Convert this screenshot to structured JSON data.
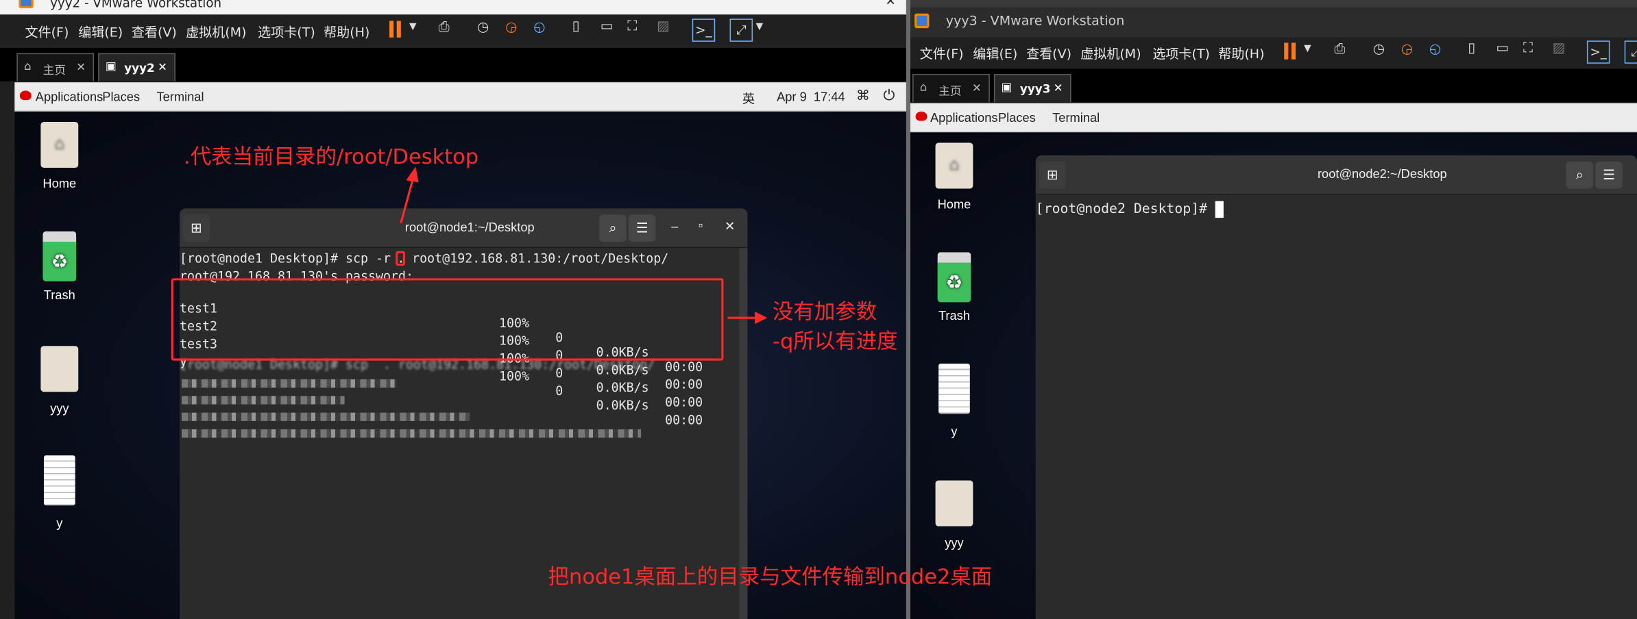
{
  "left": {
    "title": "yyy2 - VMware Workstation",
    "menu": [
      "文件(F)",
      "编辑(E)",
      "查看(V)",
      "虚拟机(M)",
      "选项卡(T)",
      "帮助(H)"
    ],
    "tabs": {
      "home": "主页",
      "vm": "yyy2"
    },
    "panel": {
      "applications": "Applications",
      "places": "Places",
      "terminal": "Terminal",
      "input": "英",
      "clock": "Apr 9  17:44"
    },
    "desktop": {
      "home": "Home",
      "trash": "Trash",
      "folder": "yyy",
      "file": "y"
    },
    "terminal": {
      "title": "root@node1:~/Desktop",
      "prompt_cmd": "[root@node1 Desktop]# scp -r ",
      "dot": ".",
      "cmd_rest": " root@192.168.81.130:/root/Desktop/",
      "password": "root@192.168.81.130's password:",
      "files": [
        {
          "name": "test1",
          "pct": "100%",
          "size": "0",
          "rate": "0.0KB/s",
          "time": "00:00"
        },
        {
          "name": "test2",
          "pct": "100%",
          "size": "0",
          "rate": "0.0KB/s",
          "time": "00:00"
        },
        {
          "name": "test3",
          "pct": "100%",
          "size": "0",
          "rate": "0.0KB/s",
          "time": "00:00"
        },
        {
          "name": "y",
          "pct": "100%",
          "size": "0",
          "rate": "0.0KB/s",
          "time": "00:00"
        }
      ],
      "blurred_line": "[root@node1 Desktop]# scp  . root@192.168.81.130:/root/Desktop/"
    }
  },
  "right": {
    "title": "yyy3 - VMware Workstation",
    "menu": [
      "文件(F)",
      "编辑(E)",
      "查看(V)",
      "虚拟机(M)",
      "选项卡(T)",
      "帮助(H)"
    ],
    "tabs": {
      "home": "主页",
      "vm": "yyy3"
    },
    "panel": {
      "applications": "Applications",
      "places": "Places",
      "terminal": "Terminal"
    },
    "desktop": {
      "home": "Home",
      "trash": "Trash",
      "file": "y",
      "folder": "yyy"
    },
    "terminal": {
      "title": "root@node2:~/Desktop",
      "prompt": "[root@node2 Desktop]# "
    }
  },
  "annotations": {
    "dot_meaning": ".代表当前目录的/root/Desktop",
    "no_param_line1": "没有加参数",
    "no_param_line2": "-q所以有进度",
    "summary": "把node1桌面上的目录与文件传输到node2桌面"
  },
  "colors": {
    "annotation": "#ff2a2a",
    "pause_icon": "#ff7a1a",
    "terminal_bg": "#2b2b2b",
    "menubar_bg": "#202020"
  }
}
